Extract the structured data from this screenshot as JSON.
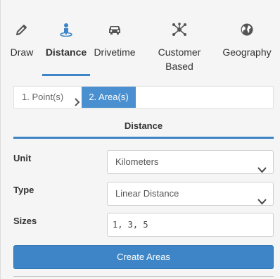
{
  "tabs": [
    {
      "label": "Draw",
      "icon": "pencil-icon"
    },
    {
      "label": "Distance",
      "icon": "person-pin-icon",
      "active": true
    },
    {
      "label": "Drivetime",
      "icon": "car-icon"
    },
    {
      "label": "Customer\nBased",
      "icon": "network-icon"
    },
    {
      "label": "Geography",
      "icon": "globe-icon"
    }
  ],
  "stepper": {
    "step1": "1. Point(s)",
    "step2": "2. Area(s)"
  },
  "section": {
    "title": "Distance"
  },
  "form": {
    "unit_label": "Unit",
    "unit_value": "Kilometers",
    "type_label": "Type",
    "type_value": "Linear Distance",
    "sizes_label": "Sizes",
    "sizes_value": "1, 3, 5"
  },
  "actions": {
    "create_label": "Create Areas"
  },
  "colors": {
    "accent": "#3d85c6",
    "icon": "#555555"
  }
}
